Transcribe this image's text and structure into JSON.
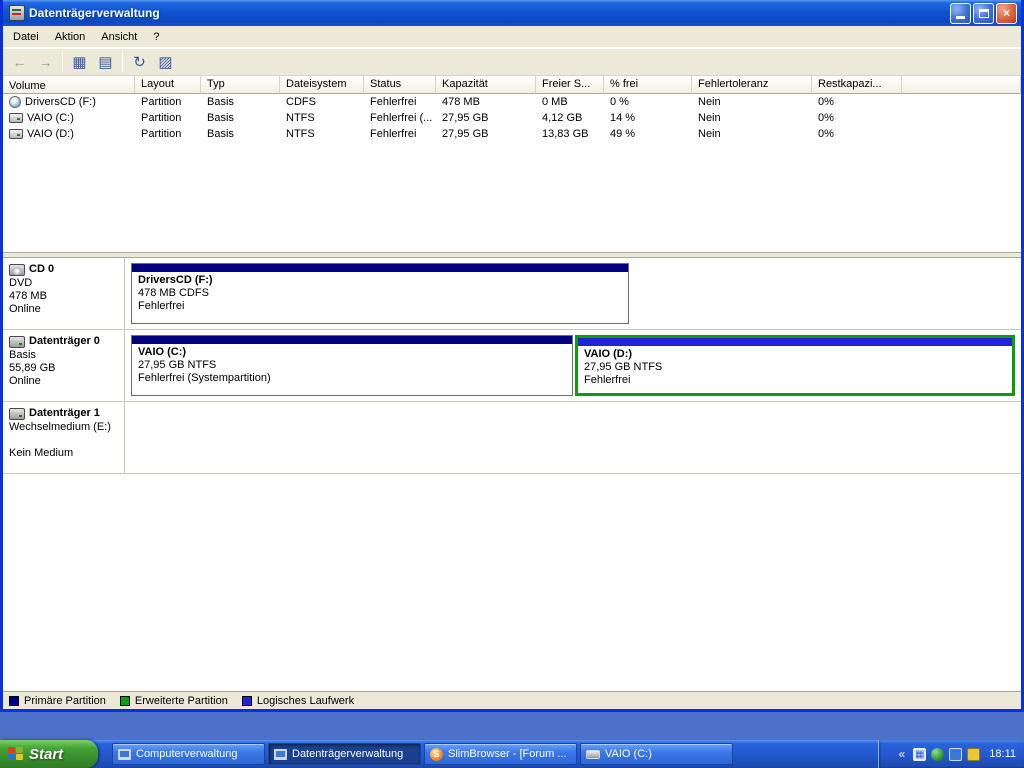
{
  "window": {
    "title": "Datenträgerverwaltung"
  },
  "menu": [
    "Datei",
    "Aktion",
    "Ansicht",
    "?"
  ],
  "toolbar": {
    "icons": [
      {
        "name": "back-icon",
        "glyph": "←"
      },
      {
        "name": "forward-icon",
        "glyph": "→"
      },
      {
        "name": "console-tree-icon",
        "glyph": "▦"
      },
      {
        "name": "properties-icon",
        "glyph": "▤"
      },
      {
        "name": "refresh-icon",
        "glyph": "↻"
      },
      {
        "name": "rescan-disks-icon",
        "glyph": "▨"
      }
    ]
  },
  "table": {
    "columns": [
      "Volume",
      "Layout",
      "Typ",
      "Dateisystem",
      "Status",
      "Kapazität",
      "Freier S...",
      "% frei",
      "Fehlertoleranz",
      "Restkapazi..."
    ],
    "rows": [
      [
        "DriversCD (F:)",
        "Partition",
        "Basis",
        "CDFS",
        "Fehlerfrei",
        "478 MB",
        "0 MB",
        "0 %",
        "Nein",
        "0%"
      ],
      [
        "VAIO (C:)",
        "Partition",
        "Basis",
        "NTFS",
        "Fehlerfrei (...",
        "27,95 GB",
        "4,12 GB",
        "14 %",
        "Nein",
        "0%"
      ],
      [
        "VAIO (D:)",
        "Partition",
        "Basis",
        "NTFS",
        "Fehlerfrei",
        "27,95 GB",
        "13,83 GB",
        "49 %",
        "Nein",
        "0%"
      ]
    ]
  },
  "disks": [
    {
      "name": "CD 0",
      "type_line": "DVD",
      "size_line": "478 MB",
      "status_line": "Online",
      "partitions": [
        {
          "title": "DriversCD (F:)",
          "size": "478 MB CDFS",
          "status": "Fehlerfrei",
          "color": "#000080"
        }
      ]
    },
    {
      "name": "Datenträger 0",
      "type_line": "Basis",
      "size_line": "55,89 GB",
      "status_line": "Online",
      "partitions": [
        {
          "title": "VAIO (C:)",
          "size": "27,95 GB NTFS",
          "status": "Fehlerfrei (Systempartition)",
          "color": "#000080"
        },
        {
          "title": "VAIO (D:)",
          "size": "27,95 GB NTFS",
          "status": "Fehlerfrei",
          "color": "#2222d8"
        }
      ]
    },
    {
      "name": "Datenträger 1",
      "type_line": "Wechselmedium (E:)",
      "size_line": "",
      "status_line": "Kein Medium",
      "partitions": []
    }
  ],
  "legend": [
    {
      "label": "Primäre Partition",
      "color": "#000080"
    },
    {
      "label": "Erweiterte Partition",
      "color": "#0a9e0a"
    },
    {
      "label": "Logisches Laufwerk",
      "color": "#2222d8"
    }
  ],
  "taskbar": {
    "start_label": "Start",
    "tasks": [
      {
        "label": "Computerverwaltung",
        "icon": "computer-icon",
        "active": false
      },
      {
        "label": "Datenträgerverwaltung",
        "icon": "computer-icon",
        "active": true
      },
      {
        "label": "SlimBrowser - [Forum ...",
        "icon": "browser-icon",
        "active": false
      },
      {
        "label": "VAIO (C:)",
        "icon": "drive-icon",
        "active": false
      }
    ],
    "browser_icon_letter": "S",
    "clock": "18:11"
  }
}
